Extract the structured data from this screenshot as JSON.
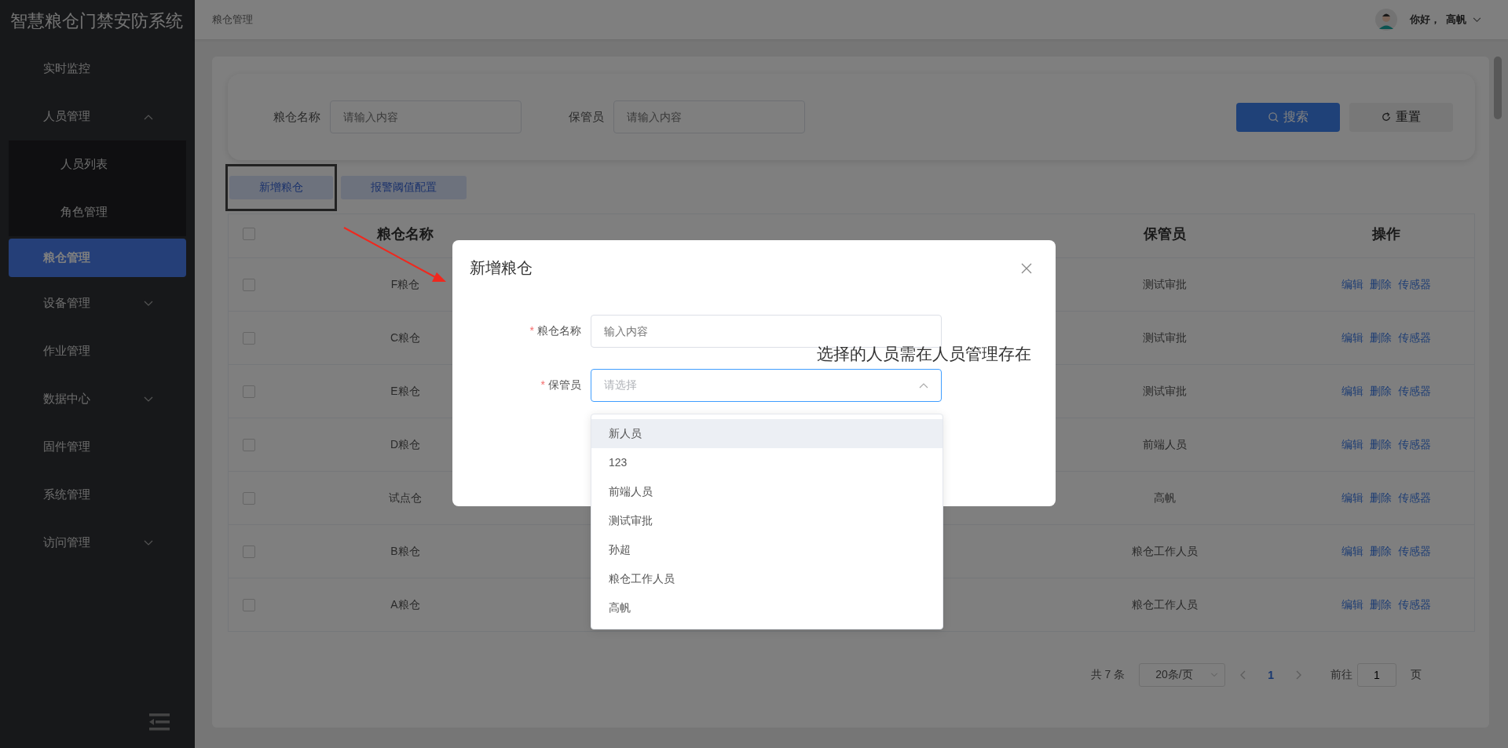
{
  "sidebar": {
    "title": "智慧粮仓门禁安防系统",
    "items": [
      {
        "label": "实时监控",
        "kind": "link",
        "selected": false
      },
      {
        "label": "人员管理",
        "kind": "group",
        "expanded": true,
        "selected": false,
        "children": [
          {
            "label": "人员列表",
            "selected": false
          },
          {
            "label": "角色管理",
            "selected": false
          }
        ]
      },
      {
        "label": "粮仓管理",
        "kind": "link",
        "selected": true
      },
      {
        "label": "设备管理",
        "kind": "group",
        "expanded": false,
        "selected": false
      },
      {
        "label": "作业管理",
        "kind": "link",
        "selected": false
      },
      {
        "label": "数据中心",
        "kind": "group",
        "expanded": false,
        "selected": false
      },
      {
        "label": "固件管理",
        "kind": "link",
        "selected": false
      },
      {
        "label": "系统管理",
        "kind": "link",
        "selected": false
      },
      {
        "label": "访问管理",
        "kind": "group",
        "expanded": false,
        "selected": false
      }
    ]
  },
  "header": {
    "breadcrumb": "粮仓管理",
    "greeting": "你好，",
    "user": "高帆"
  },
  "search": {
    "fields": [
      {
        "label": "粮仓名称",
        "placeholder": "请输入内容"
      },
      {
        "label": "保管员",
        "placeholder": "请输入内容"
      }
    ],
    "buttons": [
      {
        "label": "搜索",
        "kind": "primary"
      },
      {
        "label": "重置",
        "kind": "reset"
      }
    ]
  },
  "toolbar": {
    "buttons": [
      {
        "label": "新增粮仓",
        "highlighted": true
      },
      {
        "label": "报警阈值配置",
        "highlighted": false
      }
    ]
  },
  "table": {
    "header_checked": false,
    "columns": [
      {
        "label": "粮仓名称",
        "kind": "name"
      },
      {
        "kind": "blank"
      },
      {
        "kind": "blank"
      },
      {
        "label": "保管员",
        "kind": "keeper"
      },
      {
        "label": "操作",
        "kind": "actions"
      }
    ],
    "rows": [
      {
        "name": "F粮仓",
        "keeper": "测试审批",
        "checked": false,
        "actions": [
          "编辑",
          "删除",
          "传感器"
        ]
      },
      {
        "name": "C粮仓",
        "keeper": "测试审批",
        "checked": false,
        "actions": [
          "编辑",
          "删除",
          "传感器"
        ]
      },
      {
        "name": "E粮仓",
        "keeper": "测试审批",
        "checked": false,
        "actions": [
          "编辑",
          "删除",
          "传感器"
        ]
      },
      {
        "name": "D粮仓",
        "keeper": "前端人员",
        "checked": false,
        "actions": [
          "编辑",
          "删除",
          "传感器"
        ]
      },
      {
        "name": "试点仓",
        "keeper": "高帆",
        "checked": false,
        "actions": [
          "编辑",
          "删除",
          "传感器"
        ]
      },
      {
        "name": "B粮仓",
        "keeper": "粮仓工作人员",
        "checked": false,
        "actions": [
          "编辑",
          "删除",
          "传感器"
        ]
      },
      {
        "name": "A粮仓",
        "keeper": "粮仓工作人员",
        "checked": false,
        "actions": [
          "编辑",
          "删除",
          "传感器"
        ]
      }
    ]
  },
  "pagination": {
    "total": "共 7 条",
    "page_size": "20条/页",
    "current": "1",
    "goto_label": "前往",
    "goto_value": "1",
    "page_suffix": "页"
  },
  "dialog": {
    "title": "新增粮仓",
    "fields": [
      {
        "label": "粮仓名称",
        "required_mark": "*",
        "kind": "input",
        "placeholder": "输入内容"
      },
      {
        "label": "保管员",
        "required_mark": "*",
        "kind": "select",
        "placeholder": "请选择",
        "open": true
      }
    ],
    "options": [
      {
        "label": "新人员",
        "highlighted": true
      },
      {
        "label": "123",
        "highlighted": false
      },
      {
        "label": "前端人员",
        "highlighted": false
      },
      {
        "label": "测试审批",
        "highlighted": false
      },
      {
        "label": "孙超",
        "highlighted": false
      },
      {
        "label": "粮仓工作人员",
        "highlighted": false
      },
      {
        "label": "高帆",
        "highlighted": false
      }
    ]
  },
  "note": "选择的人员需在人员管理存在"
}
